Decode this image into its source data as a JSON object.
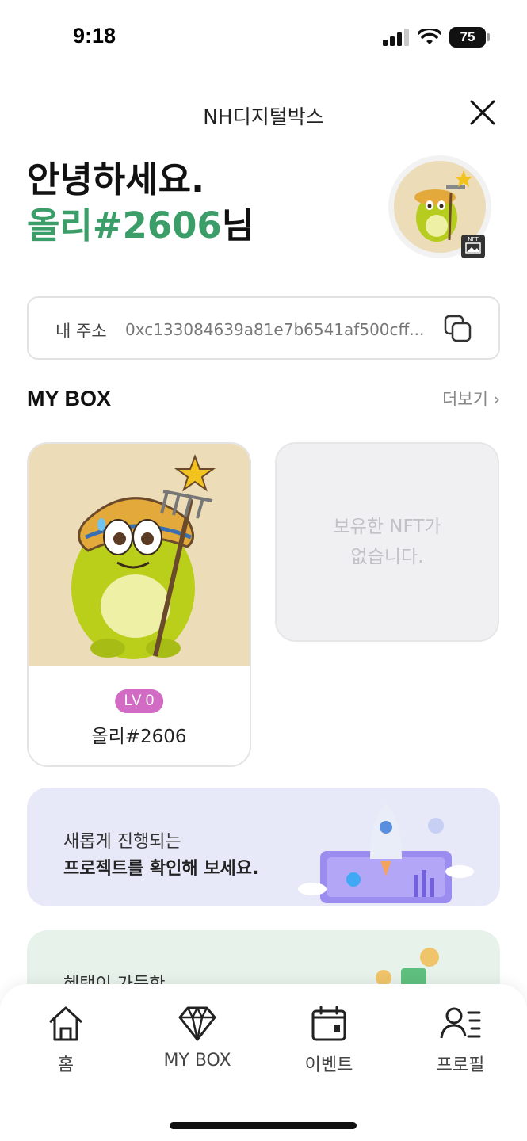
{
  "status_bar": {
    "time": "9:18",
    "battery": "75"
  },
  "header": {
    "title": "NH디지털박스",
    "close_icon": "close-icon"
  },
  "greeting": {
    "line1": "안녕하세요.",
    "name": "올리#2606",
    "suffix": "님"
  },
  "profile": {
    "badge": "NFT"
  },
  "address": {
    "label": "내 주소",
    "value": "0xc133084639a81e7b6541af500cff..."
  },
  "mybox": {
    "title": "MY BOX",
    "more": "더보기 ›"
  },
  "nft_card": {
    "level": "LV 0",
    "name": "올리#2606"
  },
  "empty_card": {
    "line1": "보유한 NFT가",
    "line2": "없습니다."
  },
  "banner": {
    "line1": "새롭게 진행되는",
    "line2": "프로젝트를 확인해 보세요."
  },
  "banner2": {
    "line1": "혜택이 가득한"
  },
  "tabs": [
    {
      "label": "홈",
      "icon": "home-icon"
    },
    {
      "label": "MY BOX",
      "icon": "diamond-icon"
    },
    {
      "label": "이벤트",
      "icon": "calendar-icon"
    },
    {
      "label": "프로필",
      "icon": "profile-list-icon"
    }
  ],
  "colors": {
    "accent": "#3b9d68",
    "level_badge": "#d26bc4",
    "banner_bg": "#e8e9f8"
  }
}
